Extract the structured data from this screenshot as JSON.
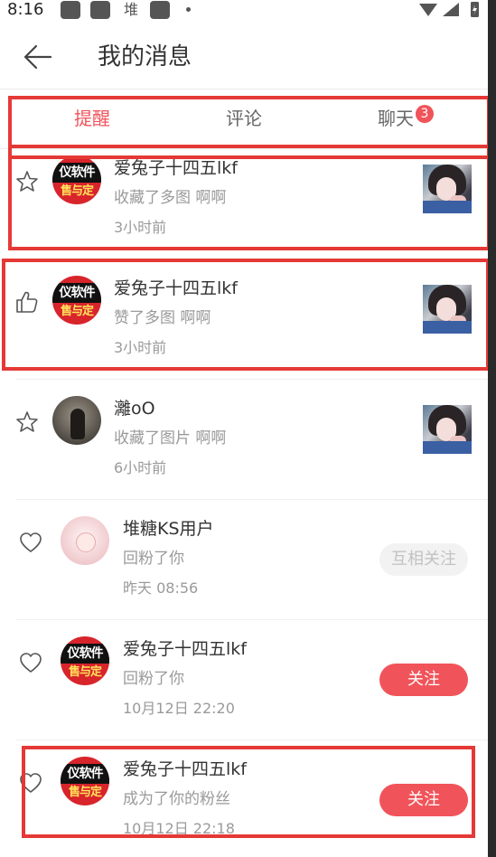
{
  "status_bar": {
    "time": "8:16",
    "char": "堆"
  },
  "header": {
    "title": "我的消息"
  },
  "tabs": [
    {
      "label": "提醒",
      "active": true
    },
    {
      "label": "评论"
    },
    {
      "label": "聊天",
      "badge": "3"
    }
  ],
  "notifications": [
    {
      "icon": "star-icon",
      "avatar_text": [
        "仪软件",
        "售与定"
      ],
      "name": "爱兔子十四五lkf",
      "action": "收藏了多图 啊啊",
      "time": "3小时前"
    },
    {
      "icon": "thumbs-up-icon",
      "avatar_text": [
        "仪软件",
        "售与定"
      ],
      "name": "爱兔子十四五lkf",
      "action": "赞了多图 啊啊",
      "time": "3小时前"
    },
    {
      "icon": "star-icon",
      "name": "灕oO",
      "action": "收藏了图片 啊啊",
      "time": "6小时前"
    },
    {
      "icon": "heart-icon",
      "name": "堆糖KS用户",
      "action": "回粉了你",
      "time": "昨天 08:56",
      "button": "互相关注"
    },
    {
      "icon": "heart-icon",
      "avatar_text": [
        "仪软件",
        "售与定"
      ],
      "name": "爱兔子十四五lkf",
      "action": "回粉了你",
      "time": "10月12日 22:20",
      "button": "关注"
    },
    {
      "icon": "heart-icon",
      "avatar_text": [
        "仪软件",
        "售与定"
      ],
      "name": "爱兔子十四五lkf",
      "action": "成为了你的粉丝",
      "time": "10月12日 22:18",
      "button": "关注"
    }
  ],
  "colors": {
    "accent": "#f0545a",
    "highlight": "#e53936"
  }
}
